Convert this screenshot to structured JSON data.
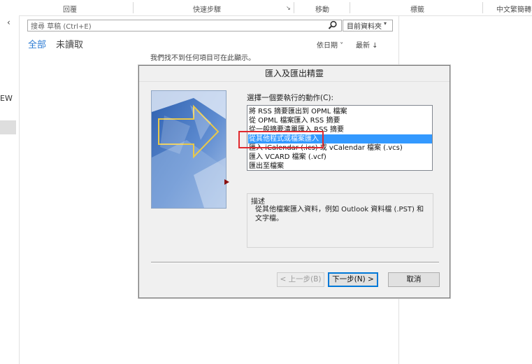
{
  "ribbon": {
    "groups": [
      "回覆",
      "快速步驟",
      "移動",
      "標籤",
      "中文繁簡轉"
    ]
  },
  "nav": {
    "collapse_glyph": "‹",
    "partial_label": "EW"
  },
  "search": {
    "placeholder": "搜尋 草稿 (Ctrl+E)",
    "scope": "目前資料夾"
  },
  "filters": {
    "all": "全部",
    "unread": "未讀取"
  },
  "sort": {
    "by": "依日期 ˅",
    "order": "最新 ↓"
  },
  "empty_message": "我們找不到任何項目可在此顯示。",
  "dialog": {
    "title": "匯入及匯出精靈",
    "action_label": "選擇一個要執行的動作(C):",
    "actions": [
      "將 RSS 摘要匯出到 OPML 檔案",
      "從 OPML 檔案匯入 RSS 摘要",
      "從一般摘要清單匯入 RSS 摘要",
      "從其他程式或檔案匯入",
      "匯入 iCalendar (.ics) 或 vCalendar 檔案 (.vcs)",
      "匯入 VCARD 檔案 (.vcf)",
      "匯出至檔案"
    ],
    "selected_index": 3,
    "description_label": "描述",
    "description_text": "從其他檔案匯入資料，例如 Outlook 資料檔 (.PST) 和文字檔。",
    "buttons": {
      "back": "< 上一步(B)",
      "next": "下一步(N) >",
      "cancel": "取消"
    }
  },
  "colors": {
    "accent": "#2b7bd3",
    "selection": "#3399ff",
    "highlight": "#e0292e"
  }
}
